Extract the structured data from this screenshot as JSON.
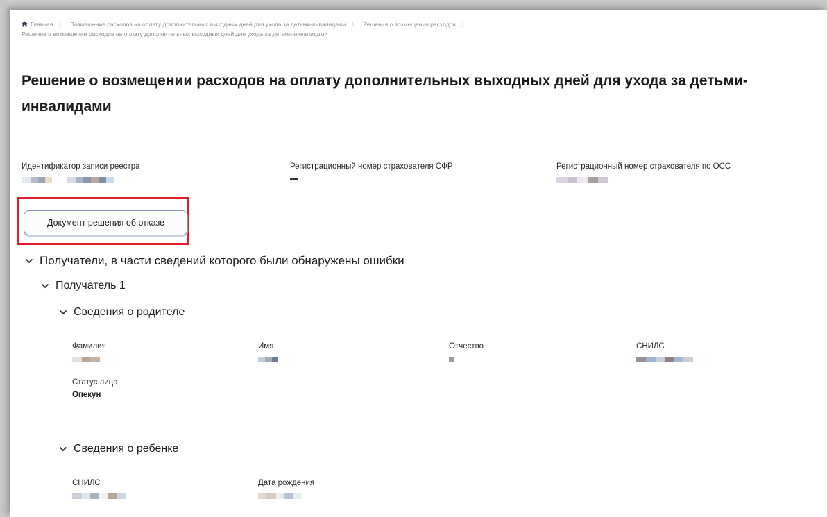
{
  "breadcrumb": {
    "home": "Главная",
    "item1": "Возмещение расходов на оплату дополнительных выходных дней для ухода за детьми-инвалидами",
    "item2": "Решения о возмещении расходов",
    "current": "Решение о возмещении расходов на оплату дополнительных выходных дней для ухода за детьми-инвалидами"
  },
  "title": "Решение о возмещении расходов на оплату дополнительных выходных дней для ухода за детьми-инвалидами",
  "registry": {
    "record_id_label": "Идентификатор записи реестра",
    "sfr_reg_label": "Регистрационный номер страхователя СФР",
    "sfr_reg_value": "—",
    "oss_reg_label": "Регистрационный номер страхователя по ОСС"
  },
  "actions": {
    "refusal_doc_button": "Документ решения об отказе"
  },
  "sections": {
    "recipients_with_errors": "Получатели, в части сведений которого были обнаружены ошибки",
    "recipient_1": "Получатель 1",
    "parent_info": "Сведения о родителе",
    "child_info": "Сведения о ребенке"
  },
  "parent": {
    "surname_label": "Фамилия",
    "name_label": "Имя",
    "patronymic_label": "Отчество",
    "snils_label": "СНИЛС",
    "status_label": "Статус лица",
    "status_value": "Опекун"
  },
  "child": {
    "snils_label": "СНИЛС",
    "birth_date_label": "Дата рождения"
  },
  "colors": {
    "highlight": "#e01e2a",
    "button_border": "#8b97b4",
    "divider": "#d3e1f0"
  }
}
